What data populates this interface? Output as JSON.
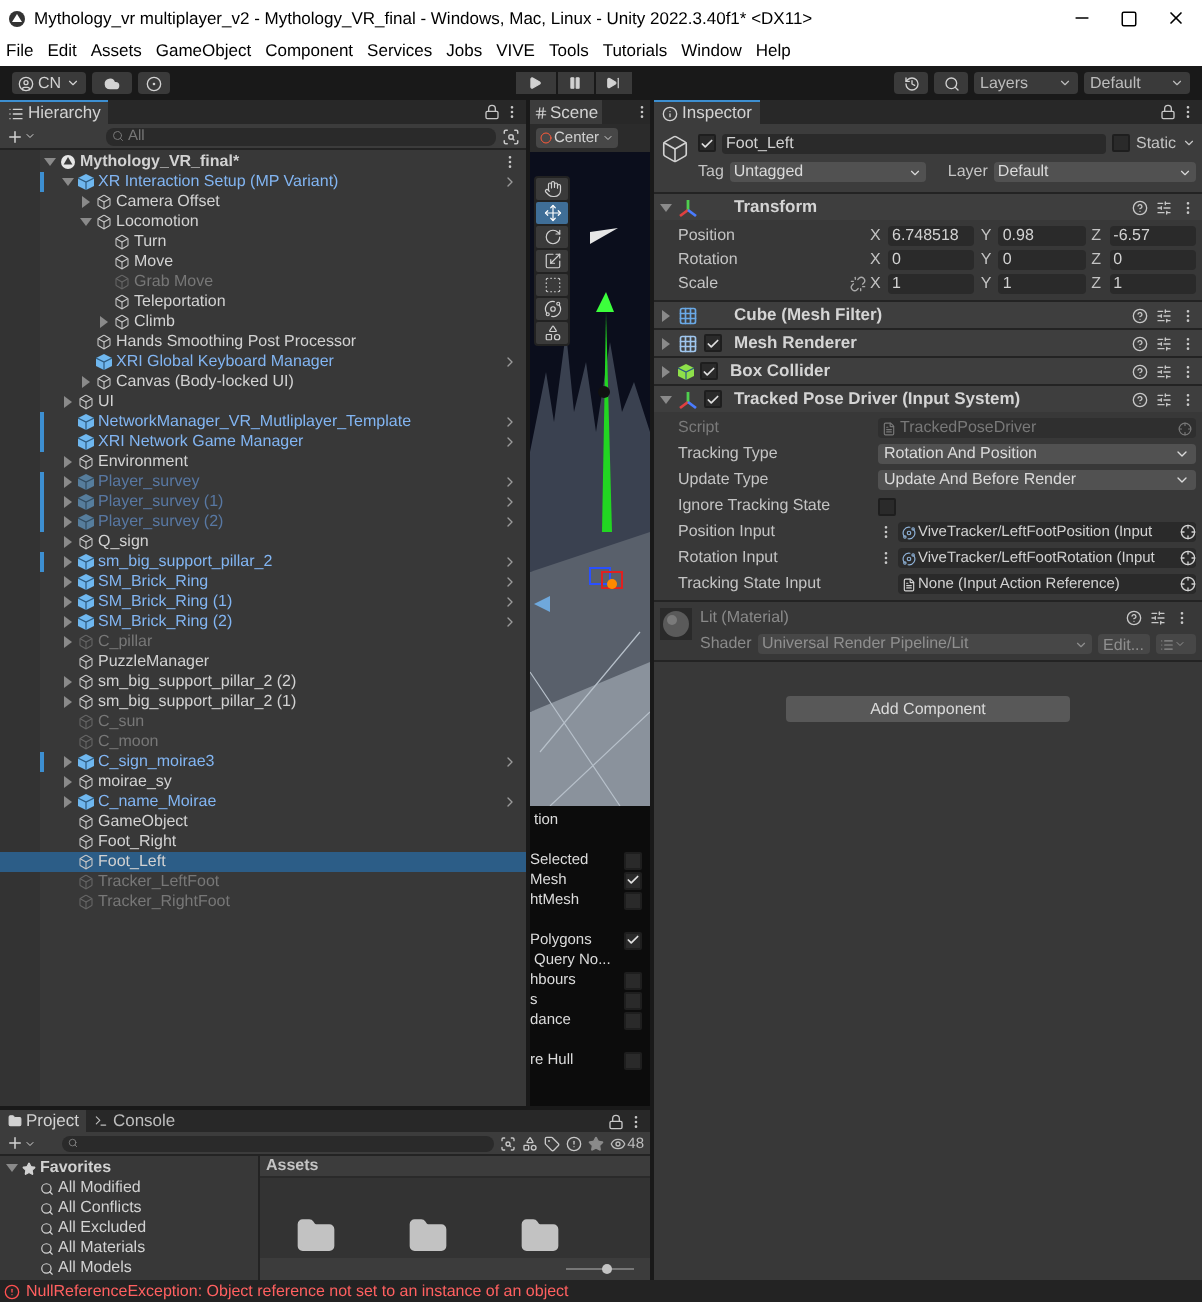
{
  "window": {
    "title": "Mythology_vr multiplayer_v2 - Mythology_VR_final - Windows, Mac, Linux - Unity 2022.3.40f1* <DX11>"
  },
  "menu": [
    "File",
    "Edit",
    "Assets",
    "GameObject",
    "Component",
    "Services",
    "Jobs",
    "VIVE",
    "Tools",
    "Tutorials",
    "Window",
    "Help"
  ],
  "toolbar": {
    "account": "CN",
    "layers": "Layers",
    "layout": "Default"
  },
  "hierarchy": {
    "title": "Hierarchy",
    "placeholder": "All",
    "items": [
      {
        "name": "Mythology_VR_final*",
        "kind": "scene",
        "expanded": true,
        "modified": false,
        "disabled": false,
        "selected": false,
        "children": [
          {
            "name": "XR Interaction Setup (MP Variant)",
            "kind": "prefab",
            "expanded": true,
            "modified": true,
            "disabled": false,
            "selected": false,
            "children": [
              {
                "name": "Camera Offset",
                "kind": "object",
                "expanded": false,
                "modified": false,
                "disabled": false,
                "selected": false
              },
              {
                "name": "Locomotion",
                "kind": "object",
                "expanded": true,
                "modified": false,
                "disabled": false,
                "selected": false,
                "children": [
                  {
                    "name": "Turn",
                    "kind": "object",
                    "modified": false,
                    "disabled": false,
                    "selected": false
                  },
                  {
                    "name": "Move",
                    "kind": "object",
                    "modified": false,
                    "disabled": false,
                    "selected": false
                  },
                  {
                    "name": "Grab Move",
                    "kind": "object",
                    "modified": false,
                    "disabled": true,
                    "selected": false
                  },
                  {
                    "name": "Teleportation",
                    "kind": "object",
                    "modified": false,
                    "disabled": false,
                    "selected": false
                  },
                  {
                    "name": "Climb",
                    "kind": "object",
                    "expanded": false,
                    "modified": false,
                    "disabled": false,
                    "selected": false
                  }
                ]
              },
              {
                "name": "Hands Smoothing Post Processor",
                "kind": "object",
                "modified": false,
                "disabled": false,
                "selected": false
              },
              {
                "name": "XRI Global Keyboard Manager",
                "kind": "prefab",
                "modified": false,
                "disabled": false,
                "selected": false
              },
              {
                "name": "Canvas (Body-locked UI)",
                "kind": "object",
                "expanded": false,
                "modified": false,
                "disabled": false,
                "selected": false
              }
            ]
          },
          {
            "name": "UI",
            "kind": "object",
            "expanded": false,
            "modified": false,
            "disabled": false,
            "selected": false
          },
          {
            "name": "NetworkManager_VR_Mutliplayer_Template",
            "kind": "prefab",
            "modified": true,
            "disabled": false,
            "selected": false
          },
          {
            "name": "XRI Network Game Manager",
            "kind": "prefab",
            "modified": true,
            "disabled": false,
            "selected": false
          },
          {
            "name": "Environment",
            "kind": "object",
            "expanded": false,
            "modified": false,
            "disabled": false,
            "selected": false
          },
          {
            "name": "Player_survey",
            "kind": "prefab",
            "expanded": false,
            "modified": true,
            "disabled": true,
            "selected": false
          },
          {
            "name": "Player_survey (1)",
            "kind": "prefab",
            "expanded": false,
            "modified": true,
            "disabled": true,
            "selected": false
          },
          {
            "name": "Player_survey (2)",
            "kind": "prefab",
            "expanded": false,
            "modified": true,
            "disabled": true,
            "selected": false
          },
          {
            "name": "Q_sign",
            "kind": "object",
            "expanded": false,
            "modified": false,
            "disabled": false,
            "selected": false
          },
          {
            "name": "sm_big_support_pillar_2",
            "kind": "prefab",
            "expanded": false,
            "modified": true,
            "disabled": false,
            "selected": false
          },
          {
            "name": "SM_Brick_Ring",
            "kind": "prefab",
            "expanded": false,
            "modified": false,
            "disabled": false,
            "selected": false
          },
          {
            "name": "SM_Brick_Ring (1)",
            "kind": "prefab",
            "expanded": false,
            "modified": false,
            "disabled": false,
            "selected": false
          },
          {
            "name": "SM_Brick_Ring (2)",
            "kind": "prefab",
            "expanded": false,
            "modified": false,
            "disabled": false,
            "selected": false
          },
          {
            "name": "C_pillar",
            "kind": "object",
            "expanded": false,
            "modified": false,
            "disabled": true,
            "selected": false
          },
          {
            "name": "PuzzleManager",
            "kind": "object",
            "modified": false,
            "disabled": false,
            "selected": false
          },
          {
            "name": "sm_big_support_pillar_2 (2)",
            "kind": "object",
            "expanded": false,
            "modified": false,
            "disabled": false,
            "selected": false
          },
          {
            "name": "sm_big_support_pillar_2 (1)",
            "kind": "object",
            "expanded": false,
            "modified": false,
            "disabled": false,
            "selected": false
          },
          {
            "name": "C_sun",
            "kind": "object",
            "modified": false,
            "disabled": true,
            "selected": false
          },
          {
            "name": "C_moon",
            "kind": "object",
            "modified": false,
            "disabled": true,
            "selected": false
          },
          {
            "name": "C_sign_moirae3",
            "kind": "prefab",
            "expanded": false,
            "modified": true,
            "disabled": false,
            "selected": false
          },
          {
            "name": "moirae_sy",
            "kind": "object",
            "expanded": false,
            "modified": false,
            "disabled": false,
            "selected": false
          },
          {
            "name": "C_name_Moirae",
            "kind": "prefab",
            "expanded": false,
            "modified": false,
            "disabled": false,
            "selected": false
          },
          {
            "name": "GameObject",
            "kind": "object",
            "modified": false,
            "disabled": false,
            "selected": false
          },
          {
            "name": "Foot_Right",
            "kind": "object",
            "modified": false,
            "disabled": false,
            "selected": false
          },
          {
            "name": "Foot_Left",
            "kind": "object",
            "modified": false,
            "disabled": false,
            "selected": true
          },
          {
            "name": "Tracker_LeftFoot",
            "kind": "object",
            "modified": false,
            "disabled": true,
            "selected": false
          },
          {
            "name": "Tracker_RightFoot",
            "kind": "object",
            "modified": false,
            "disabled": true,
            "selected": false
          }
        ]
      }
    ]
  },
  "scene": {
    "title": "Scene",
    "pivot": "Center",
    "tools": [
      {
        "kind": "hand",
        "selected": false
      },
      {
        "kind": "move",
        "selected": true
      },
      {
        "kind": "rotate",
        "selected": false
      },
      {
        "kind": "scale",
        "selected": false
      },
      {
        "kind": "rect",
        "selected": false
      },
      {
        "kind": "transform",
        "selected": false
      },
      {
        "kind": "custom",
        "selected": false
      }
    ],
    "overlay": [
      {
        "items": [
          {
            "kind": "text",
            "label": "tion"
          }
        ]
      },
      {
        "items": [
          {
            "kind": "toggle",
            "label": "Selected",
            "checked": false
          },
          {
            "kind": "toggle",
            "label": "Mesh",
            "checked": true
          },
          {
            "kind": "toggle",
            "label": "htMesh",
            "checked": false
          }
        ]
      },
      {
        "items": [
          {
            "kind": "toggle",
            "label": "Polygons",
            "checked": true
          },
          {
            "kind": "text",
            "label": "Query No..."
          },
          {
            "kind": "toggle",
            "label": "hbours",
            "checked": false
          },
          {
            "kind": "toggle",
            "label": "s",
            "checked": false
          },
          {
            "kind": "toggle",
            "label": "dance",
            "checked": false
          }
        ]
      },
      {
        "items": [
          {
            "kind": "toggle",
            "label": "re Hull",
            "checked": false
          }
        ]
      }
    ]
  },
  "inspector": {
    "title": "Inspector",
    "object": {
      "name": "Foot_Left",
      "active": true,
      "static": false,
      "static_label": "Static",
      "tag_label": "Tag",
      "tag": "Untagged",
      "layer_label": "Layer",
      "layer": "Default"
    },
    "components": [
      {
        "kind": "transform",
        "name": "Transform",
        "expanded": true,
        "rows": [
          {
            "label": "Position",
            "link": false,
            "fields": [
              {
                "axis": "X",
                "value": "6.748518"
              },
              {
                "axis": "Y",
                "value": "0.98"
              },
              {
                "axis": "Z",
                "value": "-6.57"
              }
            ]
          },
          {
            "label": "Rotation",
            "link": false,
            "fields": [
              {
                "axis": "X",
                "value": "0"
              },
              {
                "axis": "Y",
                "value": "0"
              },
              {
                "axis": "Z",
                "value": "0"
              }
            ]
          },
          {
            "label": "Scale",
            "link": true,
            "fields": [
              {
                "axis": "X",
                "value": "1"
              },
              {
                "axis": "Y",
                "value": "1"
              },
              {
                "axis": "Z",
                "value": "1"
              }
            ]
          }
        ]
      },
      {
        "kind": "mesh_filter",
        "name": "Cube (Mesh Filter)",
        "expanded": false
      },
      {
        "kind": "mesh_renderer",
        "name": "Mesh Renderer",
        "expanded": false,
        "enabled": true
      },
      {
        "kind": "box_collider",
        "name": "Box Collider",
        "expanded": false,
        "enabled": true
      },
      {
        "kind": "tracked_pose",
        "name": "Tracked Pose Driver (Input System)",
        "expanded": true,
        "enabled": true,
        "properties": [
          {
            "kind": "script",
            "label": "Script",
            "value": "TrackedPoseDriver"
          },
          {
            "kind": "dropdown",
            "label": "Tracking Type",
            "value": "Rotation And Position"
          },
          {
            "kind": "dropdown",
            "label": "Update Type",
            "value": "Update And Before Render"
          },
          {
            "kind": "toggle",
            "label": "Ignore Tracking State",
            "checked": false
          },
          {
            "kind": "reference",
            "label": "Position Input",
            "value": "ViveTracker/LeftFootPosition (Input"
          },
          {
            "kind": "reference",
            "label": "Rotation Input",
            "value": "ViveTracker/LeftFootRotation (Input"
          },
          {
            "kind": "asset",
            "label": "Tracking State Input",
            "value": "None (Input Action Reference)"
          }
        ]
      }
    ],
    "material": {
      "name": "Lit (Material)",
      "shader_label": "Shader",
      "shader": "Universal Render Pipeline/Lit",
      "edit": "Edit..."
    },
    "add_button": "Add Component"
  },
  "project": {
    "tabs": [
      {
        "kind": "project",
        "label": "Project",
        "selected": true
      },
      {
        "kind": "console",
        "label": "Console",
        "selected": false
      }
    ],
    "count": "48",
    "favorites": "Favorites",
    "searches": [
      "All Modified",
      "All Conflicts",
      "All Excluded",
      "All Materials",
      "All Models"
    ],
    "assets_title": "Assets",
    "folders": [
      {
        "kind": "folder"
      },
      {
        "kind": "folder"
      },
      {
        "kind": "folder"
      }
    ],
    "zoom": {
      "level": 0.6
    }
  },
  "status": {
    "message": "NullReferenceException: Object reference not set to an instance of an object"
  }
}
